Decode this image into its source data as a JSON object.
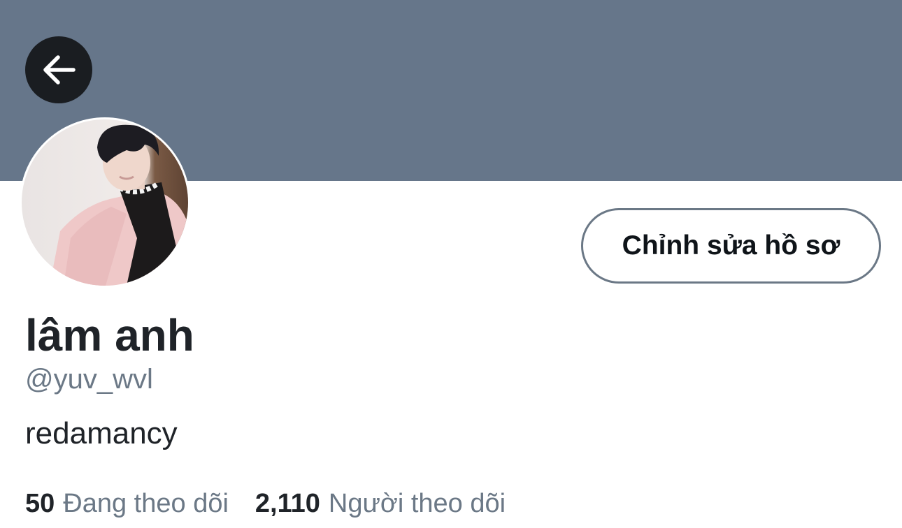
{
  "header": {
    "banner_color": "#66768a",
    "back_icon": "arrow-left-icon"
  },
  "profile": {
    "avatar_icon": "avatar-photo",
    "edit_button_label": "Chỉnh sửa hồ sơ",
    "display_name": "lâm anh",
    "handle": "@yuv_wvl",
    "bio": "redamancy"
  },
  "stats": {
    "following": {
      "count": "50",
      "label": "Đang theo dõi"
    },
    "followers": {
      "count": "2,110",
      "label": "Người theo dõi"
    }
  },
  "colors": {
    "text_primary": "#1f2328",
    "text_secondary": "#6b7886",
    "button_border": "#6b7886"
  }
}
